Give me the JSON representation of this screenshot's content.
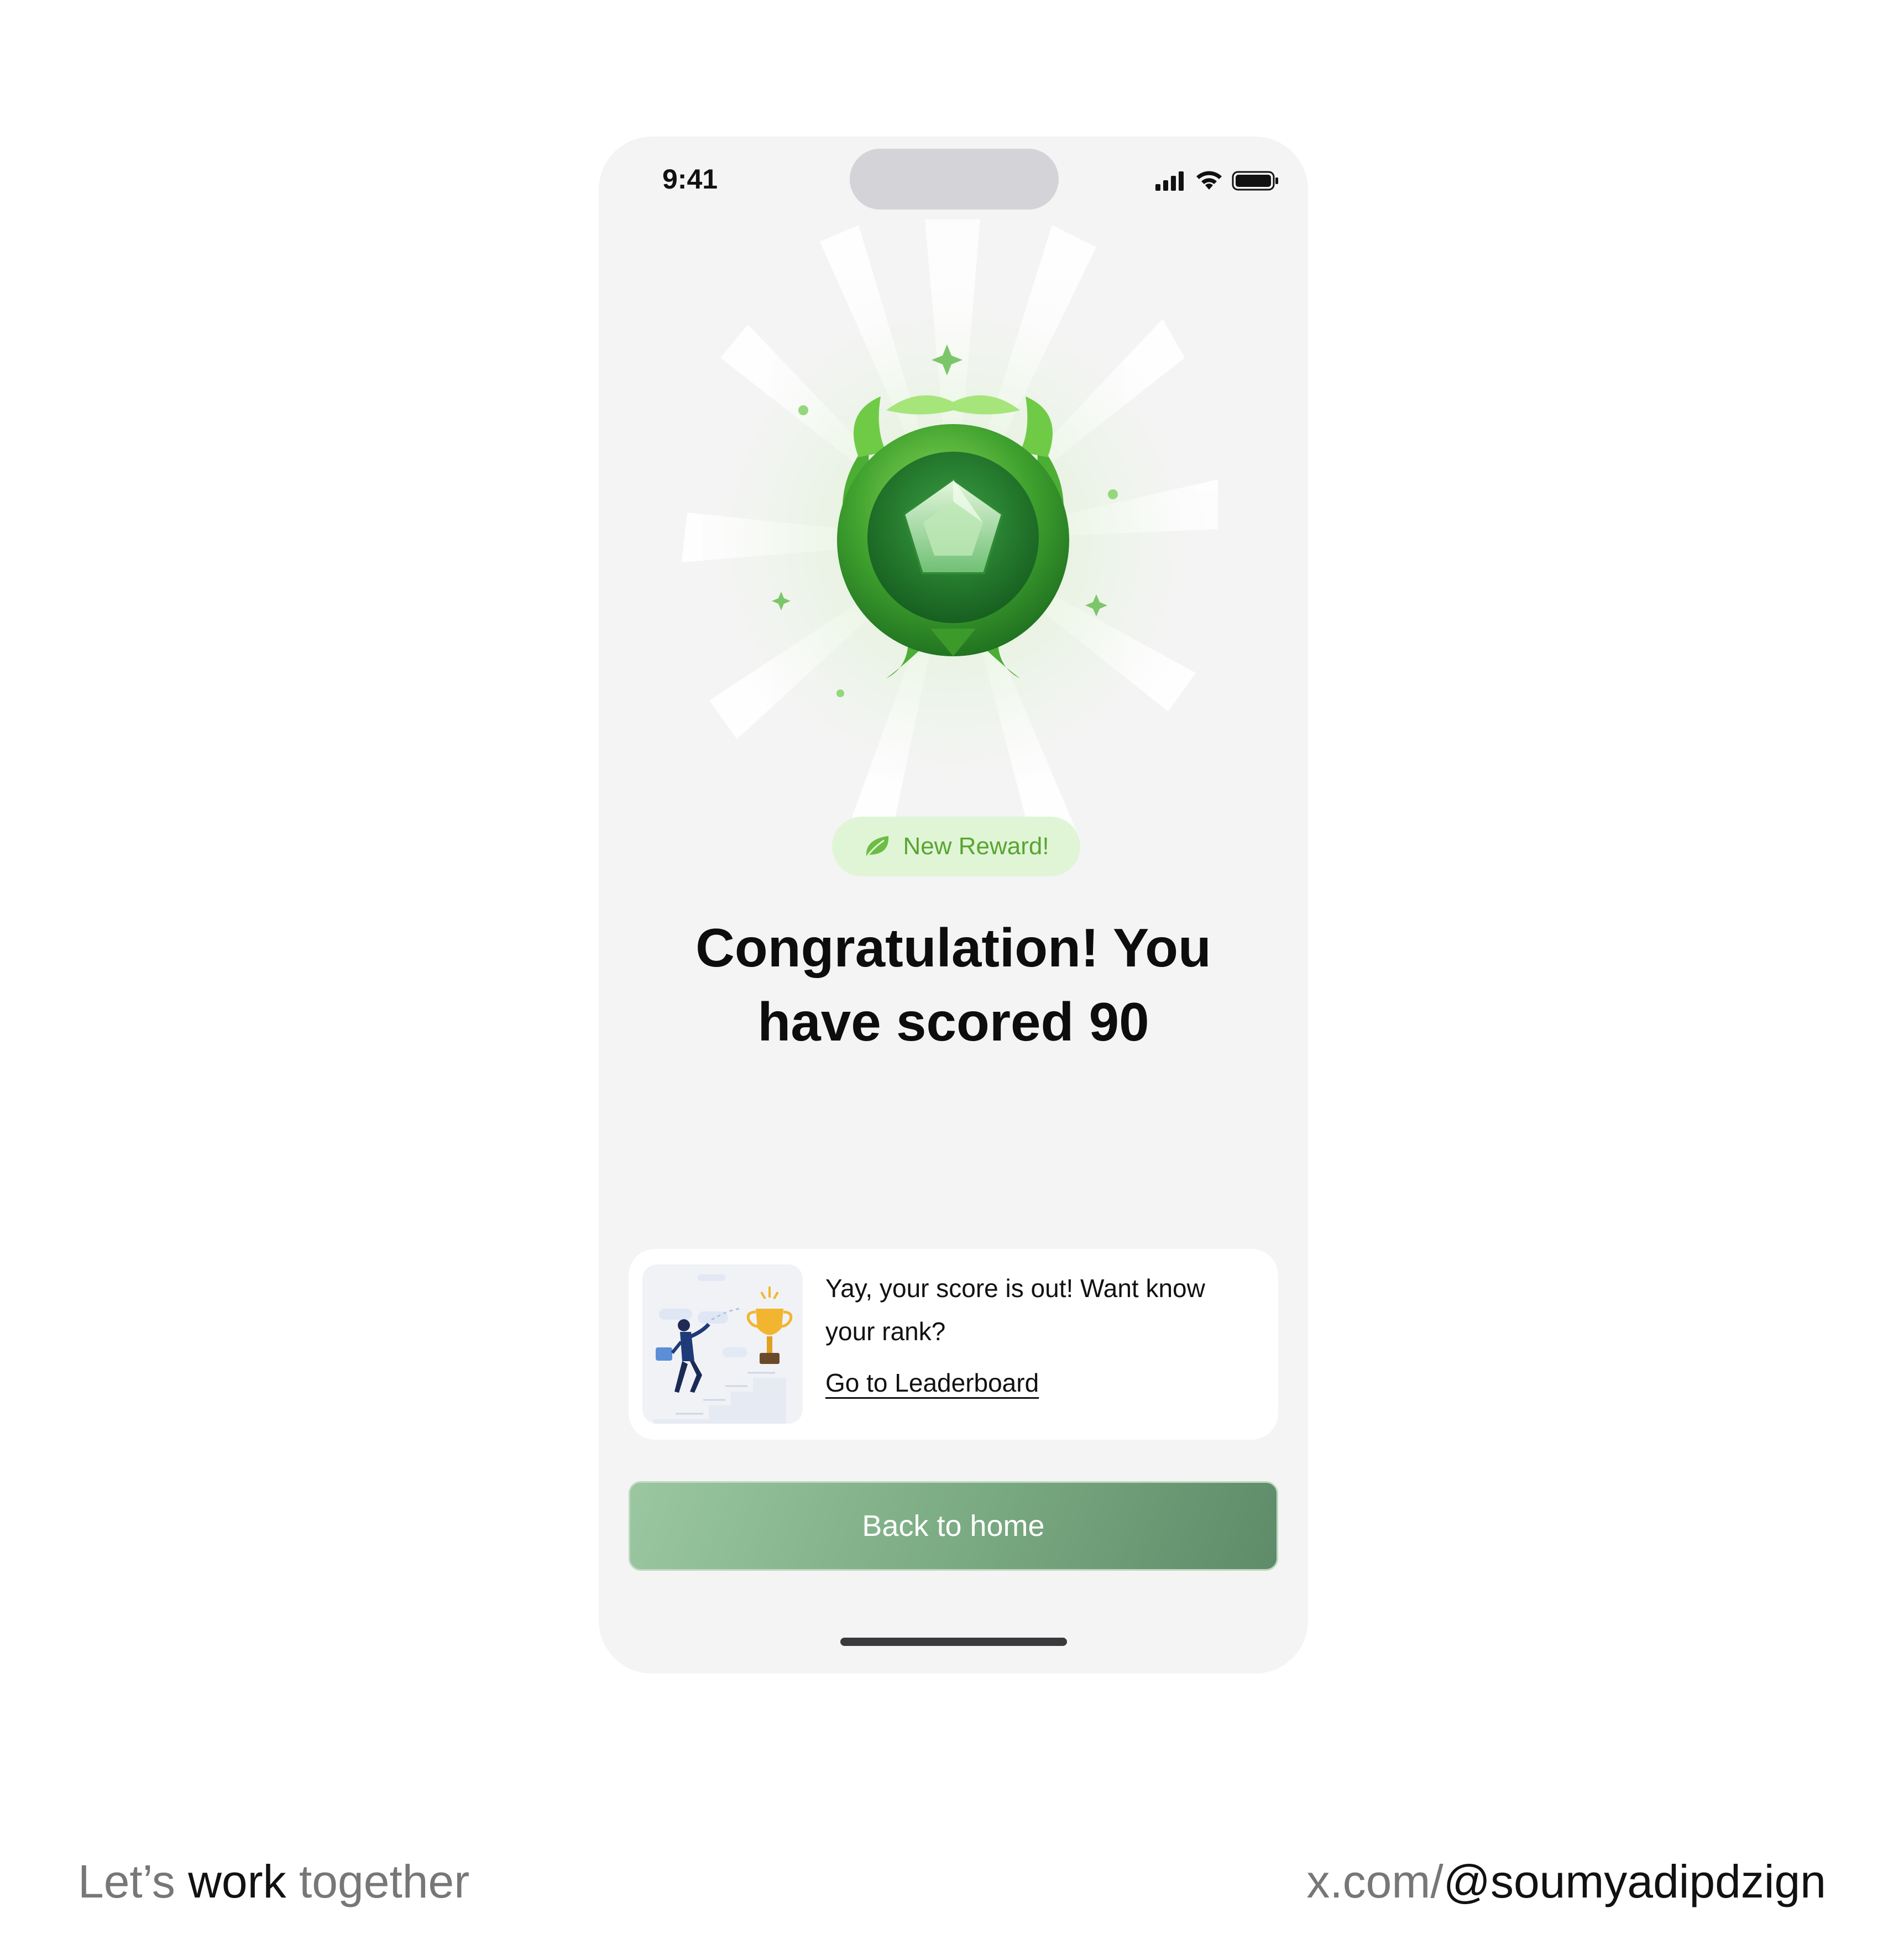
{
  "status_bar": {
    "time": "9:41"
  },
  "reward": {
    "badge_label": "New Reward!",
    "badge_icon": "leaf-icon",
    "medal_icon": "green-gem-medal-icon"
  },
  "headline": {
    "line1": "Congratulation! You",
    "line2": "have scored 90"
  },
  "leaderboard_card": {
    "illustration": "climbing-stairs-to-trophy-illustration",
    "message": "Yay, your score is out! Want know your rank?",
    "link_label": "Go to Leaderboard"
  },
  "cta": {
    "label": "Back to home"
  },
  "footer": {
    "left_prefix": "Let’s ",
    "left_bold": "work",
    "left_suffix": " together",
    "right_prefix": "x.com/",
    "right_handle": "@soumyadipdzign"
  },
  "colors": {
    "accent_green": "#5aa432",
    "pill_bg": "#e0f5d6",
    "cta_green": "#79a980",
    "screen_bg": "#f4f4f4"
  }
}
